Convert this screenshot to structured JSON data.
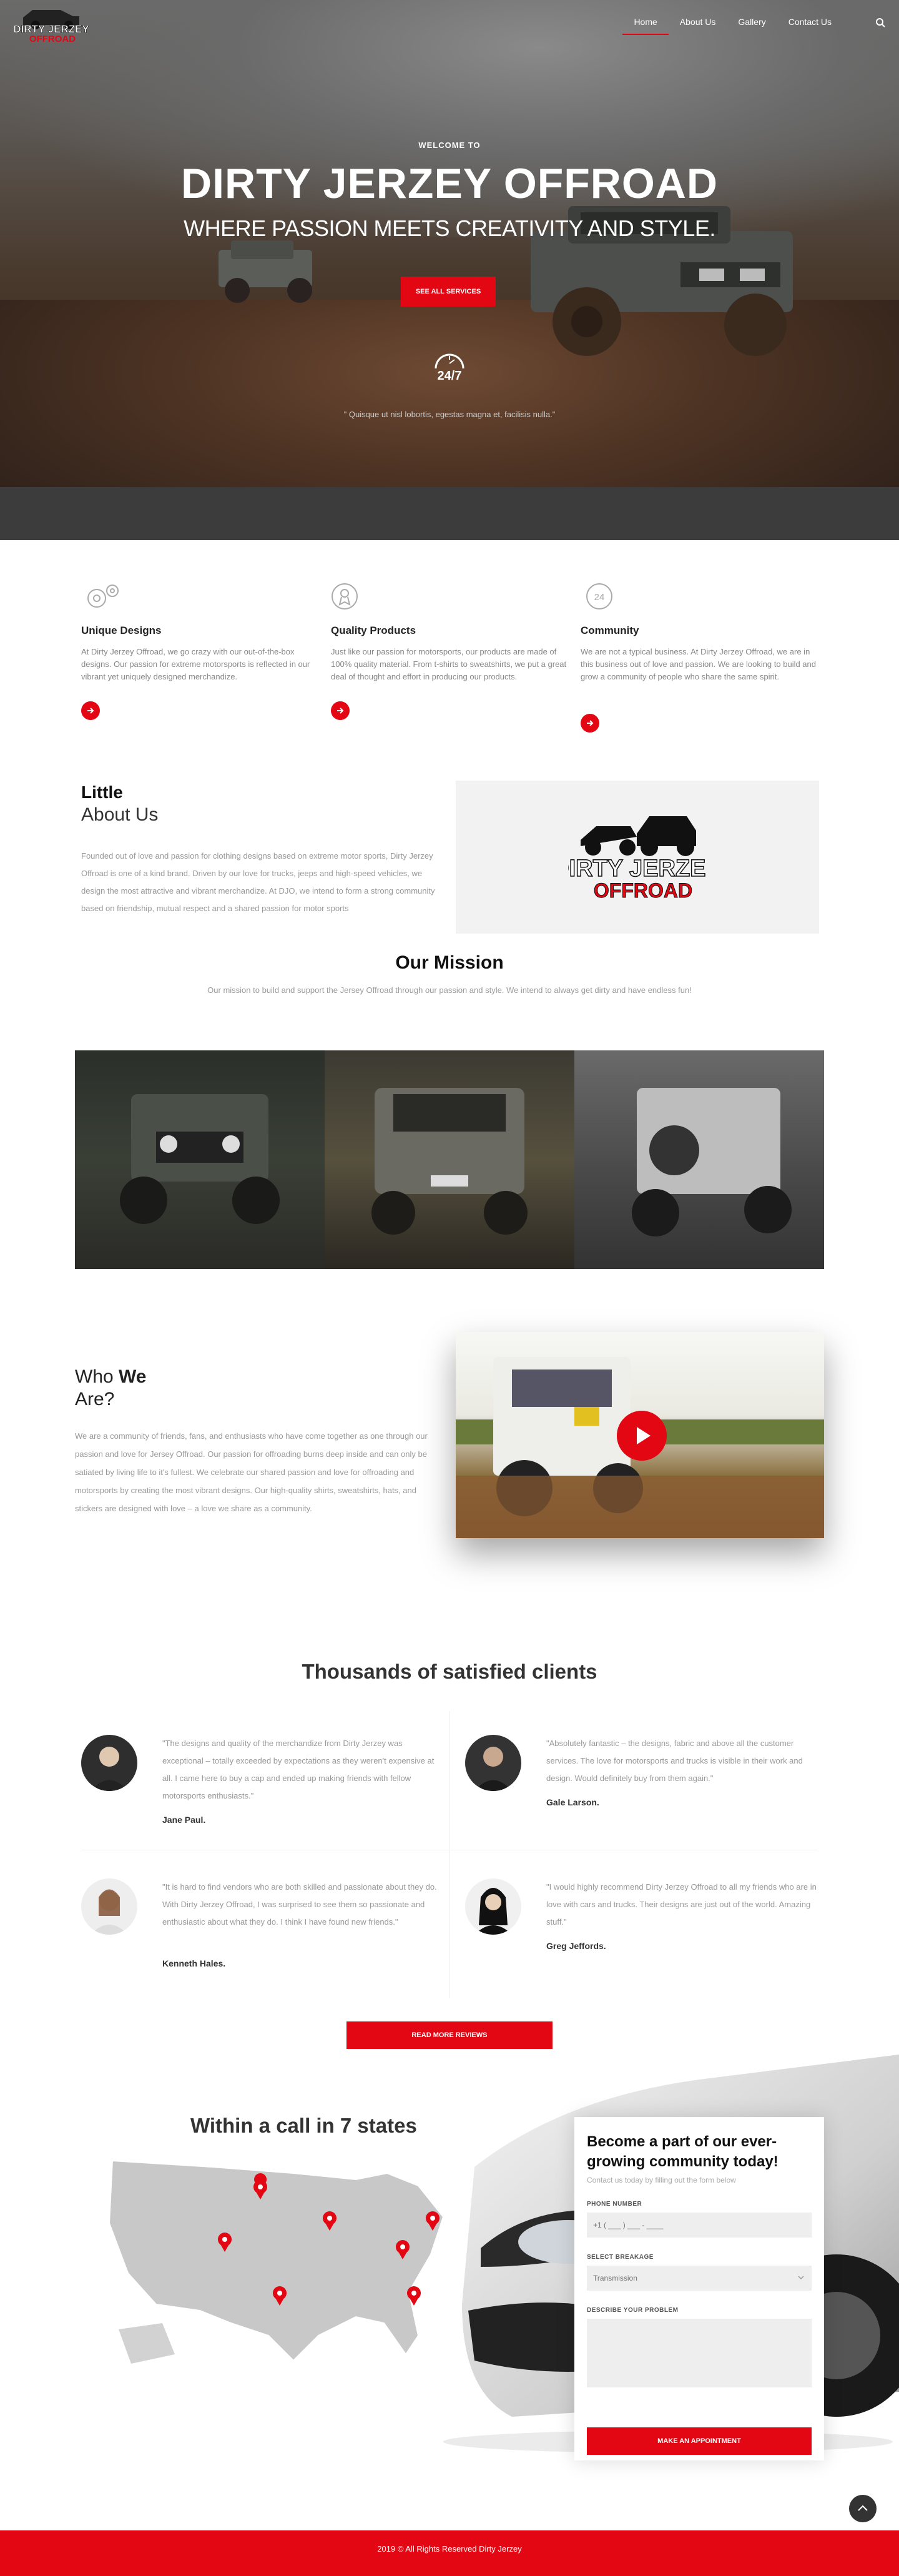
{
  "brand": {
    "logo_text_1": "DIRTY JERZEY",
    "logo_text_2": "OFFROAD",
    "accent_color": "#e30613"
  },
  "nav": {
    "items": [
      {
        "label": "Home",
        "active": true
      },
      {
        "label": "About Us",
        "active": false
      },
      {
        "label": "Gallery",
        "active": false
      },
      {
        "label": "Contact Us",
        "active": false
      }
    ],
    "search_icon": "search-icon"
  },
  "hero": {
    "welcome": "WELCOME TO",
    "title": "DIRTY JERZEY OFFROAD",
    "subtitle": "WHERE PASSION MEETS CREATIVITY AND STYLE.",
    "button": "SEE ALL SERVICES",
    "badge": "24/7",
    "quote": "\" Quisque ut nisl lobortis, egestas magna et, facilisis nulla.\""
  },
  "features": [
    {
      "icon": "gears-icon",
      "title": "Unique Designs",
      "text": "At Dirty Jerzey Offroad, we go crazy with our out-of-the-box designs. Our passion for extreme motorsports is reflected in our vibrant yet uniquely designed merchandize."
    },
    {
      "icon": "award-icon",
      "title": "Quality Products",
      "text": "Just like our passion for motorsports, our products are made of 100% quality material. From t-shirts to sweatshirts, we put a great deal of thought and effort in producing our products."
    },
    {
      "icon": "community-24-icon",
      "title": "Community",
      "text": "We are not a typical business. At Dirty Jerzey Offroad, we are in this business out of love and passion. We are looking to build and grow a community of people who share the same spirit."
    }
  ],
  "about": {
    "heading_1": "Little",
    "heading_2": "About Us",
    "text": "Founded out of love and passion for clothing designs based on extreme motor sports, Dirty Jerzey Offroad is one of a kind brand. Driven by our love for trucks, jeeps and high-speed vehicles, we design the most attractive and vibrant merchandize. At DJO, we intend to form a strong community based on friendship, mutual respect and a shared passion for motor sports"
  },
  "mission": {
    "heading": "Our Mission",
    "text": "Our mission to build and support the Jersey Offroad through our passion and style. We intend to always get dirty and have endless fun!"
  },
  "who": {
    "heading_1a": "Who ",
    "heading_1b": "We",
    "heading_2": "Are?",
    "text": "We are a community of friends, fans, and enthusiasts who have come together as one through our passion and love for Jersey Offroad. Our passion for offroading burns deep inside and can only be satiated by living life to it's fullest. We celebrate our shared passion and love for offroading and motorsports by creating the most vibrant designs. Our high-quality shirts, sweatshirts, hats, and stickers are designed with love – a love we share as a community."
  },
  "testimonials": {
    "heading_a": "Thousands ",
    "heading_b": "of satisfied clients",
    "items": [
      {
        "quote": "\"The designs and quality of the merchandize from Dirty Jerzey was exceptional – totally exceeded by expectations as they weren't expensive at all. I came here to buy a cap and ended up making friends with fellow motorsports enthusiasts.\"",
        "name": "Jane Paul."
      },
      {
        "quote": "\"Absolutely fantastic – the designs, fabric and above all the customer services. The love for motorsports and trucks is visible in their work and design. Would definitely buy from them again.\"",
        "name": "Gale Larson."
      },
      {
        "quote": "\"It is hard to find vendors who are both skilled and passionate about they do. With Dirty Jerzey Offroad, I was surprised to see them so passionate and enthusiastic about what they do. I think I have found new friends.\"",
        "name": "Kenneth Hales."
      },
      {
        "quote": "\"I would highly recommend Dirty Jerzey Offroad to all my friends who are in love with cars and trucks. Their designs are just out of the world. Amazing stuff.\"",
        "name": "Greg Jeffords."
      }
    ],
    "button": "READ MORE REVIEWS"
  },
  "states": {
    "heading_a": "Within a call ",
    "heading_b": "in 7 states"
  },
  "form": {
    "title": "Become a part of our ever-growing community today!",
    "subtitle": "Contact us today by filling out the form below",
    "phone_label": "PHONE NUMBER",
    "phone_value": "+1 ( ___ ) ___ - ____",
    "breakage_label": "SELECT BREAKAGE",
    "breakage_value": "Transmission",
    "problem_label": "DESCRIBE YOUR PROBLEM",
    "submit": "MAKE AN APPOINTMENT"
  },
  "footer": {
    "text": "2019 © All Rights Reserved Dirty Jerzey"
  }
}
